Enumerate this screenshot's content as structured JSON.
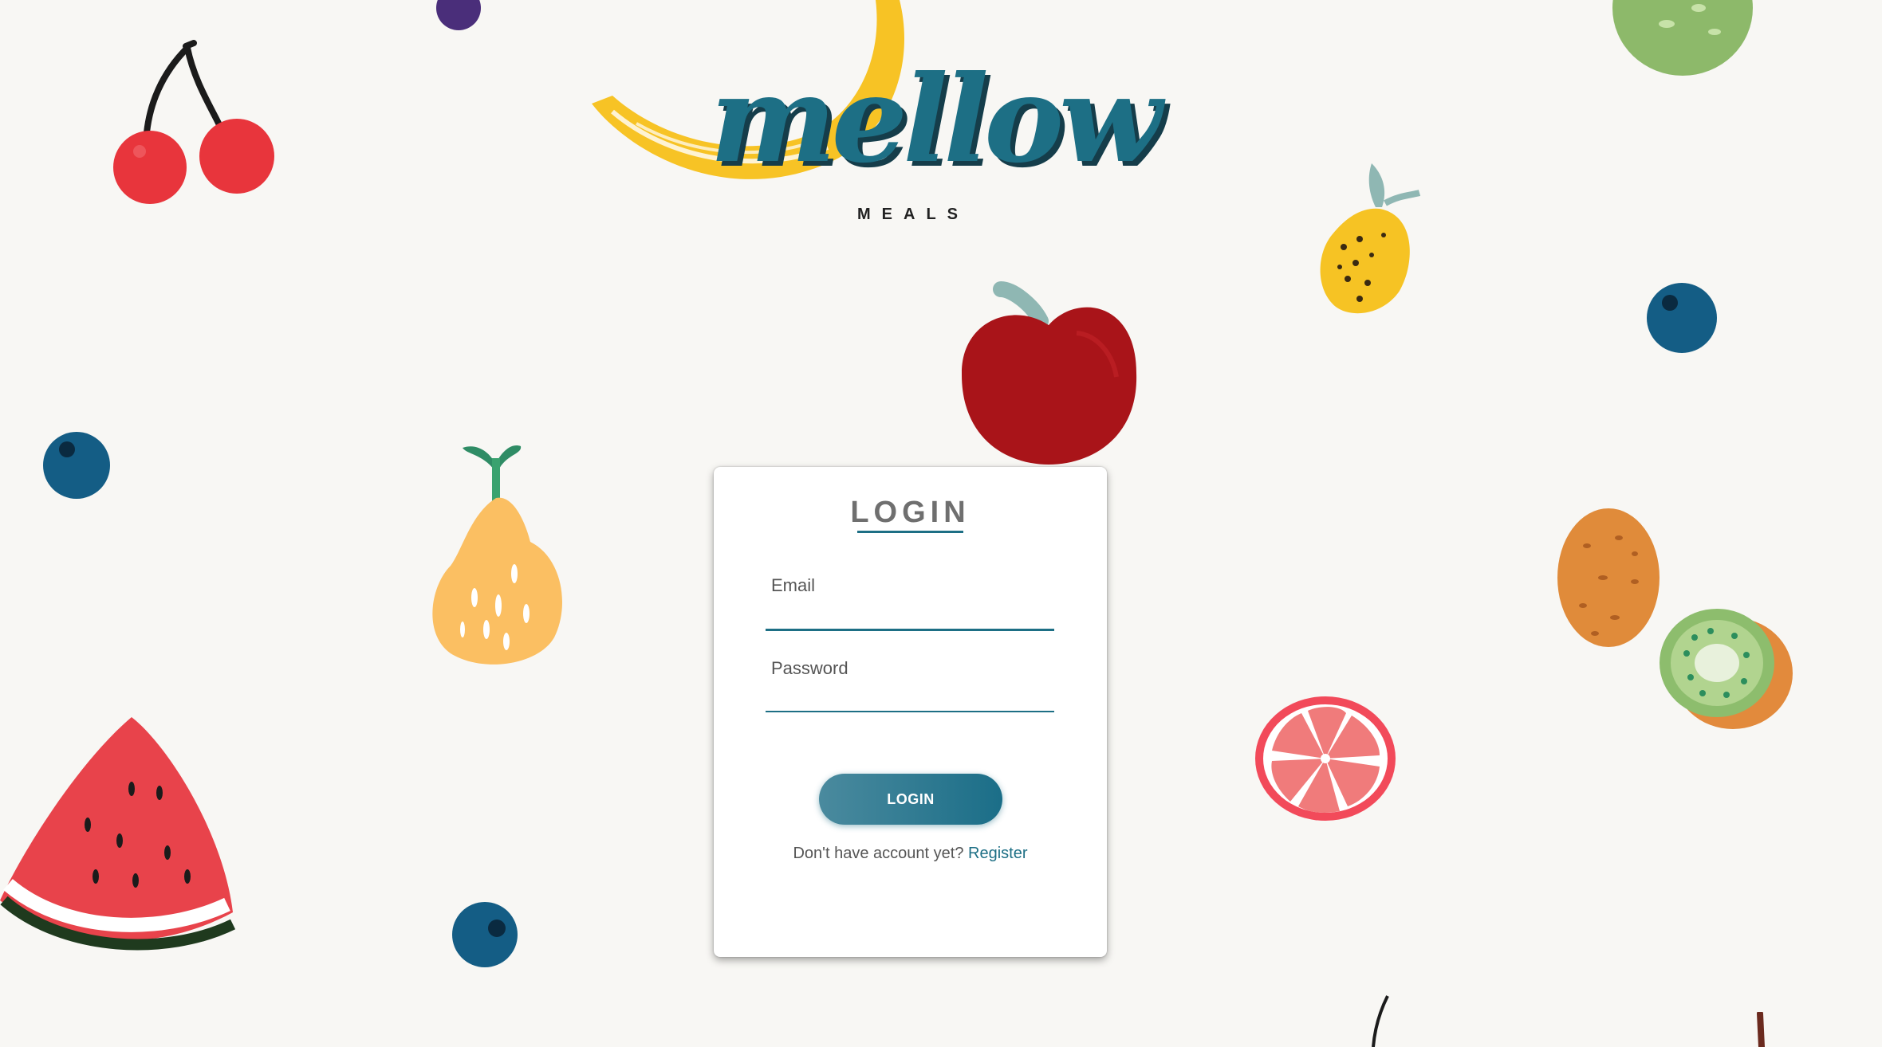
{
  "logo": {
    "brand": "mellow",
    "subtitle": "MEALS"
  },
  "login_card": {
    "title": "LOGIN",
    "email_label": "Email",
    "email_value": "",
    "password_label": "Password",
    "password_value": "",
    "submit_label": "LOGIN",
    "register_prompt": "Don't have account yet?",
    "register_link": "Register"
  },
  "colors": {
    "background": "#f8f7f4",
    "accent": "#1d6f85",
    "card": "#ffffff"
  },
  "decorations": [
    "cherry-icon",
    "banana-icon",
    "apple-icon",
    "lemon-icon",
    "blueberry-icon",
    "pear-icon",
    "watermelon-icon",
    "grapefruit-icon",
    "potato-icon",
    "kiwi-icon",
    "lime-icon"
  ]
}
